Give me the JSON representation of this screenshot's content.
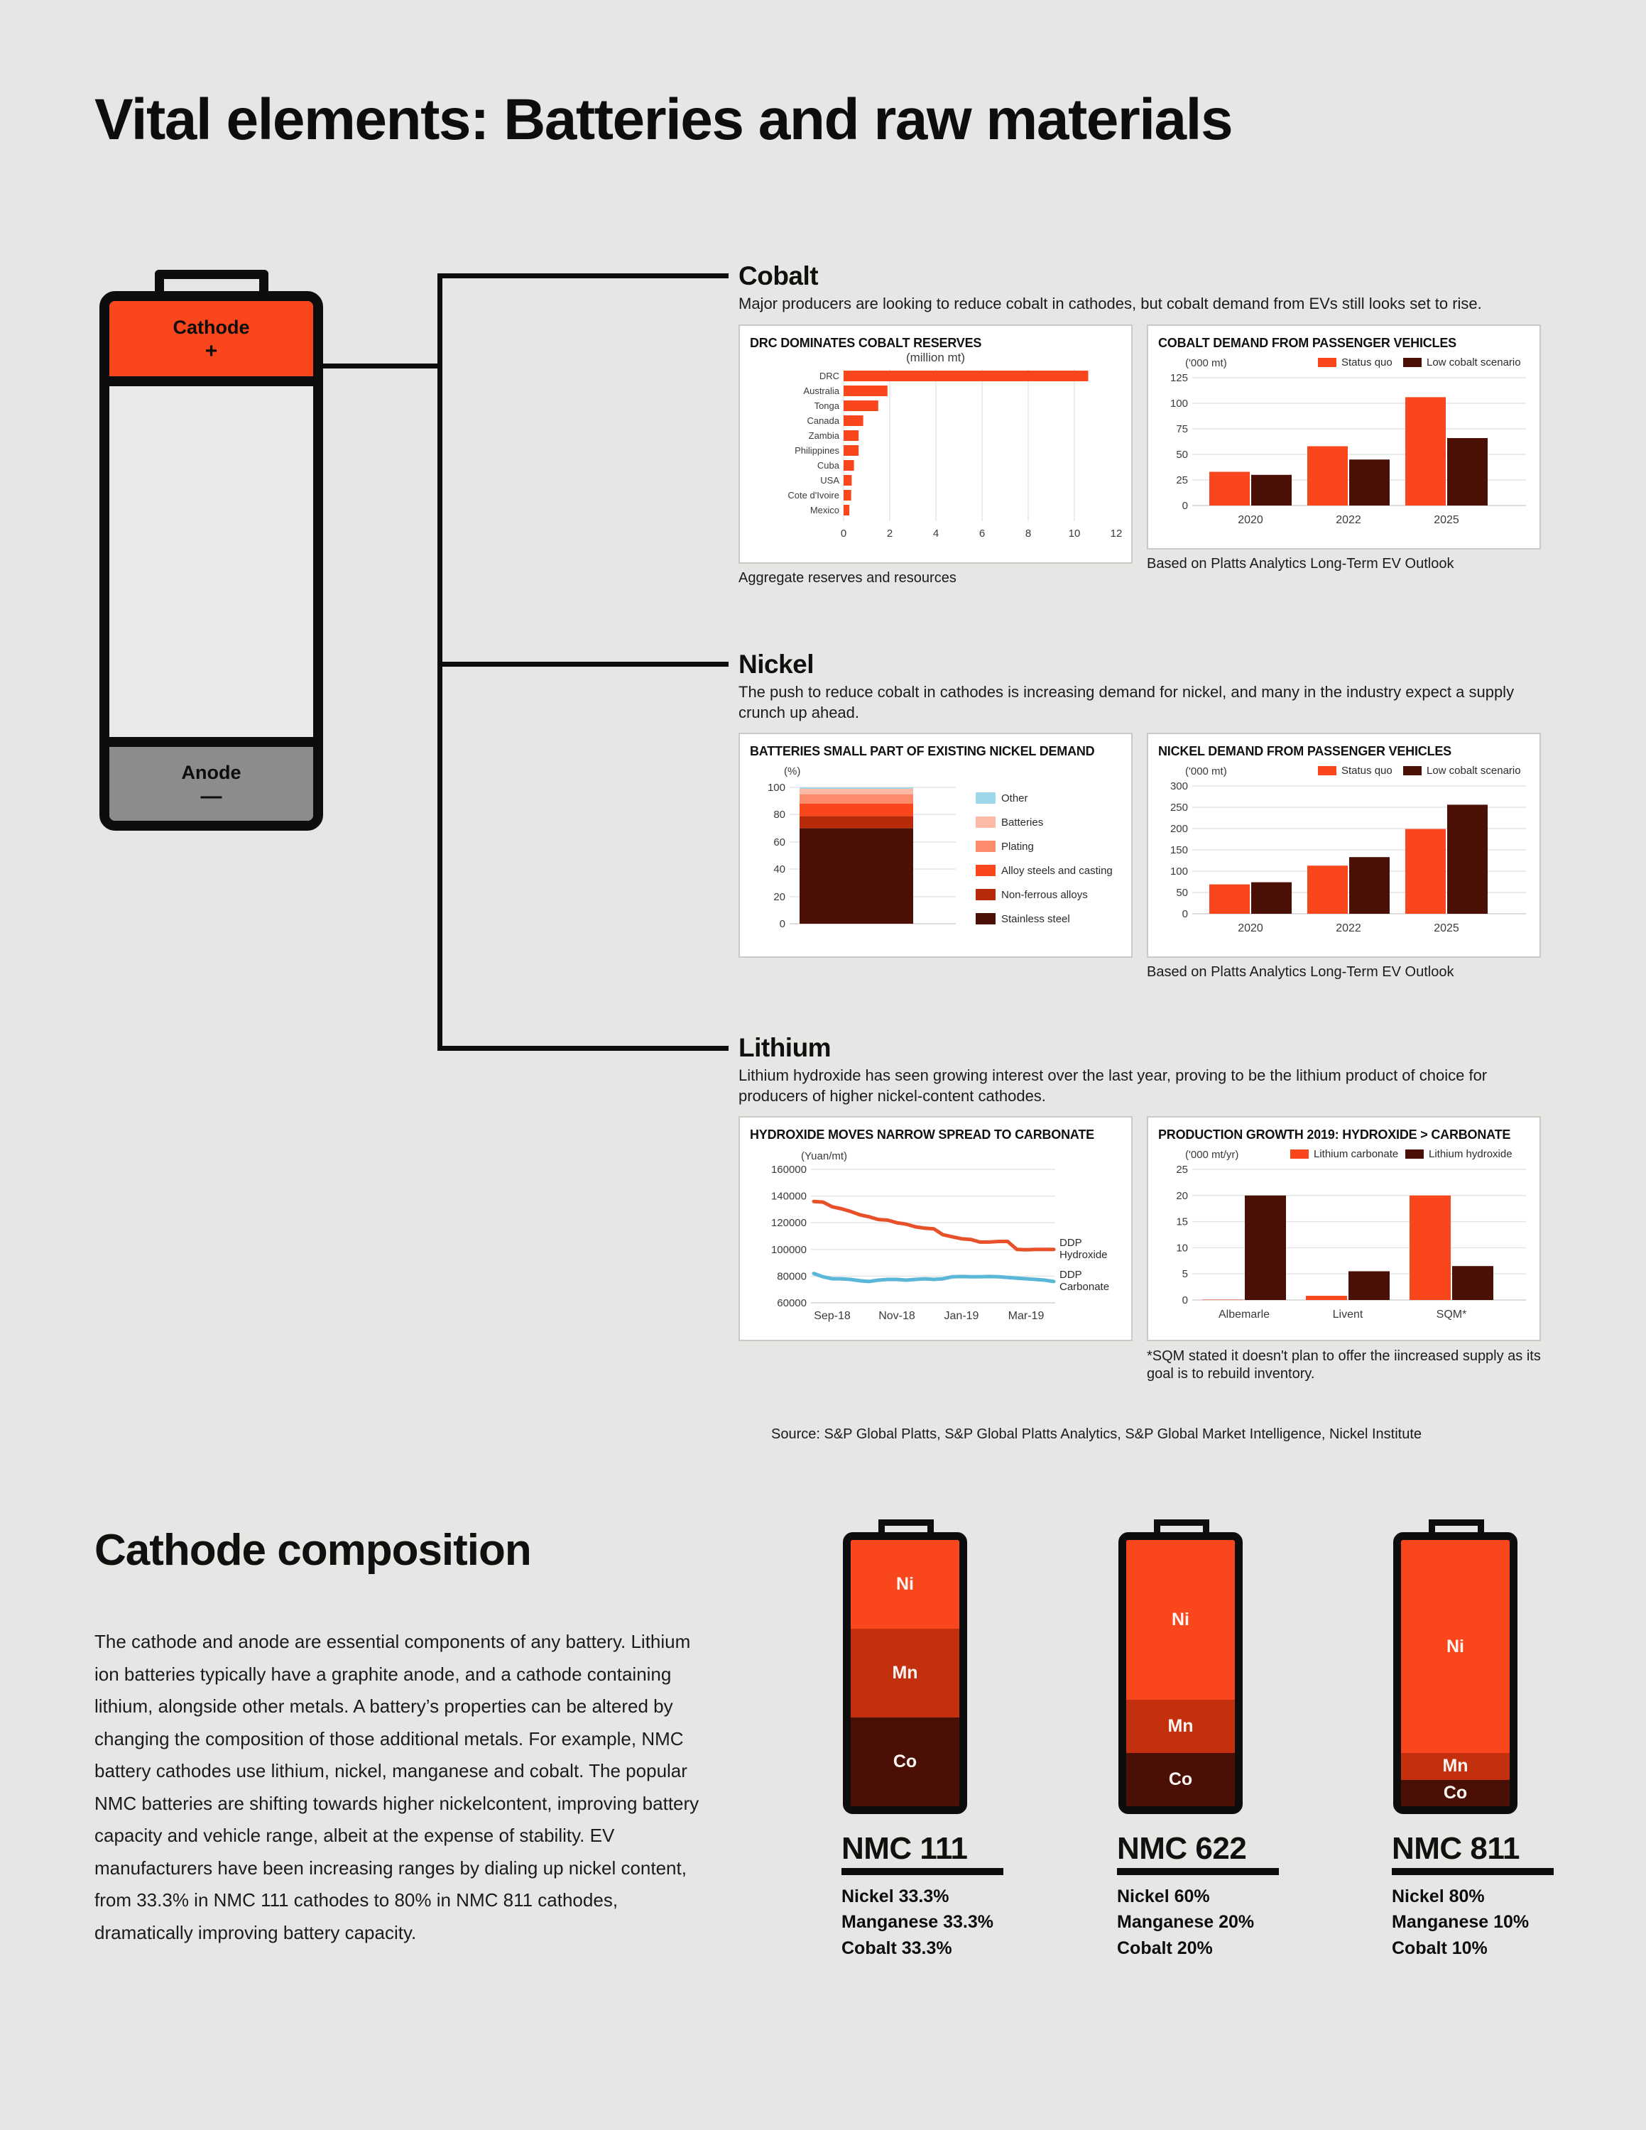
{
  "title": "Vital elements: Batteries and raw materials",
  "battery_diagram": {
    "cathode_label": "Cathode",
    "cathode_polarity": "+",
    "anode_label": "Anode",
    "anode_polarity": "—"
  },
  "sections": [
    {
      "name": "Cobalt",
      "description": "Major producers are looking to reduce cobalt in cathodes, but cobalt demand from EVs still looks set to rise.",
      "left_caption": "Aggregate reserves and resources",
      "right_caption": "Based on Platts Analytics Long-Term EV Outlook"
    },
    {
      "name": "Nickel",
      "description": "The push to reduce cobalt in cathodes is increasing demand for nickel, and many in the industry expect a supply crunch up ahead.",
      "right_caption": "Based on Platts Analytics Long-Term EV Outlook"
    },
    {
      "name": "Lithium",
      "description": "Lithium hydroxide has seen growing interest over the last year, proving to be the lithium product of choice for producers of higher nickel-content cathodes.",
      "right_footnote": "*SQM stated it doesn't plan to offer the iincreased supply as its goal is to rebuild inventory."
    }
  ],
  "source": "Source: S&P Global Platts, S&P Global Platts Analytics, S&P Global Market Intelligence, Nickel Institute",
  "colors": {
    "orange": "#f9461c",
    "dark_maroon": "#4a1005",
    "mid_red": "#c2300d",
    "light_salmon": "#fb8b6b",
    "pink": "#fcb9a6",
    "light_blue": "#9ed6ea",
    "line_red": "#e8502a",
    "line_blue": "#5bb7d8",
    "background": "#e6e7e4"
  },
  "chart_data": [
    {
      "id": "cobalt-reserves",
      "type": "bar",
      "orientation": "horizontal",
      "title": "DRC DOMINATES COBALT RESERVES",
      "unit": "(million mt)",
      "xlabel": "",
      "ylabel": "",
      "xlim": [
        0,
        12
      ],
      "xticks": [
        0,
        2,
        4,
        6,
        8,
        10,
        12
      ],
      "grid": true,
      "categories": [
        "DRC",
        "Australia",
        "Tonga",
        "Canada",
        "Zambia",
        "Philippines",
        "Cuba",
        "USA",
        "Cote d'Ivoire",
        "Mexico"
      ],
      "values": [
        10.6,
        1.9,
        1.5,
        0.85,
        0.65,
        0.65,
        0.45,
        0.35,
        0.33,
        0.25
      ],
      "color": "#f9461c"
    },
    {
      "id": "cobalt-demand",
      "type": "bar",
      "title": "COBALT DEMAND FROM PASSENGER VEHICLES",
      "unit": "('000 mt)",
      "categories": [
        "2020",
        "2022",
        "2025"
      ],
      "ylim": [
        0,
        125
      ],
      "yticks": [
        0,
        25,
        50,
        75,
        100,
        125
      ],
      "grid": true,
      "legend_position": "top-right",
      "series": [
        {
          "name": "Status quo",
          "values": [
            33,
            58,
            106
          ],
          "color": "#f9461c"
        },
        {
          "name": "Low cobalt scenario",
          "values": [
            30,
            45,
            66
          ],
          "color": "#4a1005"
        }
      ]
    },
    {
      "id": "nickel-demand-share",
      "type": "bar",
      "stacked": true,
      "title": "BATTERIES SMALL PART OF EXISTING NICKEL DEMAND",
      "unit": "(%)",
      "ylim": [
        0,
        100
      ],
      "yticks": [
        0,
        20,
        40,
        60,
        80,
        100
      ],
      "grid": true,
      "legend_position": "right",
      "categories": [
        "Nickel demand"
      ],
      "series": [
        {
          "name": "Stainless steel",
          "values": [
            70
          ],
          "color": "#4a1005"
        },
        {
          "name": "Non-ferrous alloys",
          "values": [
            9
          ],
          "color": "#b62a09"
        },
        {
          "name": "Alloy steels and casting",
          "values": [
            9
          ],
          "color": "#f9461c"
        },
        {
          "name": "Plating",
          "values": [
            7
          ],
          "color": "#fb8b6b"
        },
        {
          "name": "Batteries",
          "values": [
            4
          ],
          "color": "#fcb9a6"
        },
        {
          "name": "Other",
          "values": [
            1
          ],
          "color": "#9ed6ea"
        }
      ]
    },
    {
      "id": "nickel-demand-pv",
      "type": "bar",
      "title": "NICKEL DEMAND FROM PASSENGER VEHICLES",
      "unit": "('000 mt)",
      "categories": [
        "2020",
        "2022",
        "2025"
      ],
      "ylim": [
        0,
        300
      ],
      "yticks": [
        0,
        50,
        100,
        150,
        200,
        250,
        300
      ],
      "grid": true,
      "legend_position": "top-right",
      "series": [
        {
          "name": "Status quo",
          "values": [
            69,
            113,
            199
          ],
          "color": "#f9461c"
        },
        {
          "name": "Low cobalt scenario",
          "values": [
            74,
            133,
            256
          ],
          "color": "#4a1005"
        }
      ]
    },
    {
      "id": "lithium-prices",
      "type": "line",
      "title": "HYDROXIDE MOVES NARROW SPREAD TO CARBONATE",
      "unit": "(Yuan/mt)",
      "ylim": [
        60000,
        160000
      ],
      "yticks": [
        60000,
        80000,
        100000,
        120000,
        140000,
        160000
      ],
      "xticks": [
        "Sep-18",
        "Nov-18",
        "Jan-19",
        "Mar-19"
      ],
      "grid": true,
      "series": [
        {
          "name": "DDP Hydroxide",
          "color": "#e8502a",
          "values": [
            136000,
            135500,
            132000,
            130500,
            128500,
            126000,
            124500,
            122500,
            122000,
            120000,
            119000,
            117000,
            116000,
            115500,
            110000,
            108500,
            107000,
            106500,
            104500,
            104500,
            105000,
            105000,
            100000,
            99800,
            100000,
            100000,
            100000
          ]
        },
        {
          "name": "DDP Carbonate",
          "color": "#5bb7d8",
          "values": [
            82500,
            80000,
            78500,
            78500,
            78000,
            77000,
            76500,
            77500,
            78000,
            78000,
            77500,
            78000,
            78500,
            78000,
            78500,
            80000,
            80200,
            80000,
            80000,
            80200,
            80000,
            79500,
            79000,
            78500,
            78000,
            77500,
            76500
          ]
        }
      ]
    },
    {
      "id": "lithium-production-growth",
      "type": "bar",
      "title": "PRODUCTION GROWTH 2019: HYDROXIDE > CARBONATE",
      "unit": "('000 mt/yr)",
      "categories": [
        "Albemarle",
        "Livent",
        "SQM*"
      ],
      "ylim": [
        0,
        25
      ],
      "yticks": [
        0,
        5,
        10,
        15,
        20,
        25
      ],
      "grid": true,
      "legend_position": "top-right",
      "series": [
        {
          "name": "Lithium carbonate",
          "values": [
            0,
            0.8,
            20
          ],
          "color": "#f9461c"
        },
        {
          "name": "Lithium hydroxide",
          "values": [
            20,
            5.5,
            6.5
          ],
          "color": "#4a1005"
        }
      ]
    }
  ],
  "cathode_composition": {
    "title": "Cathode composition",
    "body": "The cathode and anode are essential components of any battery. Lithium ion batteries typically have a graphite anode, and a cathode containing lithium, alongside other metals. A battery’s properties can be altered by changing the composition of those additional metals. For example, NMC battery cathodes use lithium, nickel, manganese and cobalt. The popular NMC batteries are shifting towards higher nickelcontent, improving battery capacity and vehicle range, albeit at the expense of stability. EV manufacturers have been increasing ranges by dialing up nickel content, from 33.3% in NMC 111 cathodes to 80% in NMC 811 cathodes, dramatically improving battery capacity.",
    "batteries": [
      {
        "name": "NMC 111",
        "segments": [
          {
            "label": "Ni",
            "pct": 33.3,
            "color": "#f9461c"
          },
          {
            "label": "Mn",
            "pct": 33.3,
            "color": "#c2300d"
          },
          {
            "label": "Co",
            "pct": 33.4,
            "color": "#4a1005"
          }
        ],
        "lines": [
          "Nickel 33.3%",
          "Manganese 33.3%",
          "Cobalt 33.3%"
        ]
      },
      {
        "name": "NMC 622",
        "segments": [
          {
            "label": "Ni",
            "pct": 60,
            "color": "#f9461c"
          },
          {
            "label": "Mn",
            "pct": 20,
            "color": "#c2300d"
          },
          {
            "label": "Co",
            "pct": 20,
            "color": "#4a1005"
          }
        ],
        "lines": [
          "Nickel 60%",
          "Manganese 20%",
          "Cobalt 20%"
        ]
      },
      {
        "name": "NMC 811",
        "segments": [
          {
            "label": "Ni",
            "pct": 80,
            "color": "#f9461c"
          },
          {
            "label": "Mn",
            "pct": 10,
            "color": "#c2300d"
          },
          {
            "label": "Co",
            "pct": 10,
            "color": "#4a1005"
          }
        ],
        "lines": [
          "Nickel 80%",
          "Manganese 10%",
          "Cobalt 10%"
        ]
      }
    ]
  }
}
